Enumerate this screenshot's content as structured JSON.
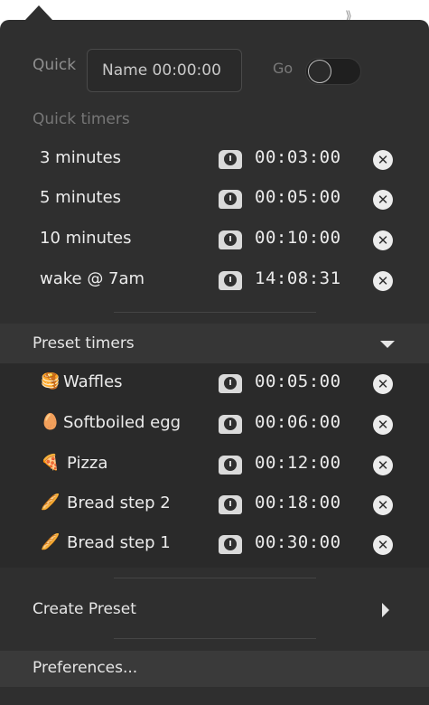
{
  "quick": {
    "label": "Quick",
    "name_placeholder": "Name 00:00:00",
    "go_label": "Go",
    "toggle_on": false
  },
  "quick_timers": {
    "heading": "Quick timers",
    "items": [
      {
        "name": "3 minutes",
        "time": "00:03:00"
      },
      {
        "name": "5 minutes",
        "time": "00:05:00"
      },
      {
        "name": "10 minutes",
        "time": "00:10:00"
      },
      {
        "name": "wake @ 7am",
        "time": "14:08:31"
      }
    ]
  },
  "preset_timers": {
    "heading": "Preset timers",
    "items": [
      {
        "emoji": "🥞",
        "name": "Waffles",
        "time": "00:05:00"
      },
      {
        "emoji": "🥚",
        "name": "Softboiled egg",
        "time": "00:06:00"
      },
      {
        "emoji": "🍕",
        "name": "Pizza",
        "time": "00:12:00"
      },
      {
        "emoji": "🥖",
        "name": "Bread step 2",
        "time": "00:18:00"
      },
      {
        "emoji": "🥖",
        "name": "Bread step 1",
        "time": "00:30:00"
      }
    ]
  },
  "menu": {
    "create_preset": "Create Preset",
    "preferences": "Preferences..."
  },
  "icons": {
    "timer": "alarm-clock-icon",
    "remove": "close-circle-icon",
    "expand": "chevron-down-icon",
    "submenu": "chevron-right-icon"
  },
  "colors": {
    "menu_bg": "#2f2f2f",
    "preset_bg": "#2a2a2a",
    "header_bg": "#363636",
    "hover_bg": "#3a3a3a",
    "text": "#ececec",
    "muted": "#767676"
  }
}
